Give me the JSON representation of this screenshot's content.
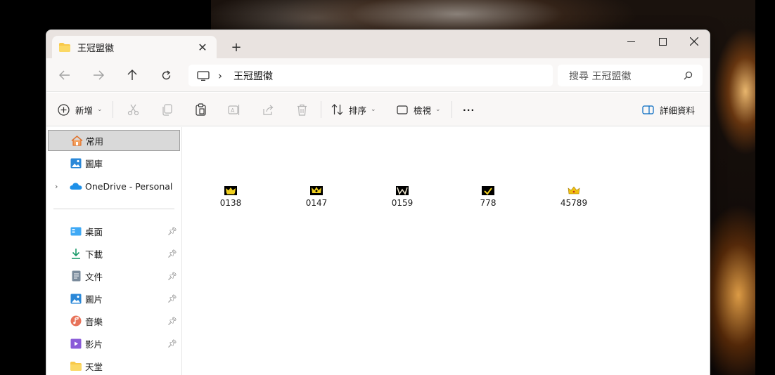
{
  "window": {
    "tab_title": "王冠盟徽",
    "new_tab_label": "+",
    "controls": {
      "minimize": "—",
      "maximize": "□",
      "close": "✕"
    }
  },
  "navigation": {
    "back_icon": "arrow-left-icon",
    "forward_icon": "arrow-right-icon",
    "up_icon": "arrow-up-icon",
    "refresh_icon": "refresh-icon",
    "breadcrumb_separator": "›",
    "breadcrumb": [
      "王冠盟徽"
    ],
    "search_placeholder": "搜尋 王冠盟徽"
  },
  "toolbar": {
    "new_label": "新增",
    "sort_label": "排序",
    "view_label": "檢視",
    "more_label": "···",
    "details_label": "詳細資料"
  },
  "sidebar": {
    "items": [
      {
        "label": "常用",
        "icon": "home-icon",
        "selected": true
      },
      {
        "label": "圖庫",
        "icon": "gallery-icon"
      },
      {
        "label": "OneDrive - Personal",
        "icon": "onedrive-cloud-icon",
        "expandable": true
      },
      {
        "label": "桌面",
        "icon": "desktop-icon",
        "pinned": true
      },
      {
        "label": "下載",
        "icon": "download-icon",
        "pinned": true
      },
      {
        "label": "文件",
        "icon": "documents-icon",
        "pinned": true
      },
      {
        "label": "圖片",
        "icon": "pictures-icon",
        "pinned": true
      },
      {
        "label": "音樂",
        "icon": "music-icon",
        "pinned": true
      },
      {
        "label": "影片",
        "icon": "videos-icon",
        "pinned": true
      },
      {
        "label": "天堂",
        "icon": "folder-icon"
      }
    ]
  },
  "files": [
    {
      "name": "0138"
    },
    {
      "name": "0147"
    },
    {
      "name": "0159"
    },
    {
      "name": "778"
    },
    {
      "name": "45789"
    }
  ],
  "colors": {
    "accent": "#0067c0",
    "folder_yellow": "#f8c94a",
    "crown_gold": "#f0d020",
    "titlebar_bg": "#e9e3e0",
    "toolbar_bg": "#f9f7f6",
    "selected_bg": "#d9d9d9"
  }
}
